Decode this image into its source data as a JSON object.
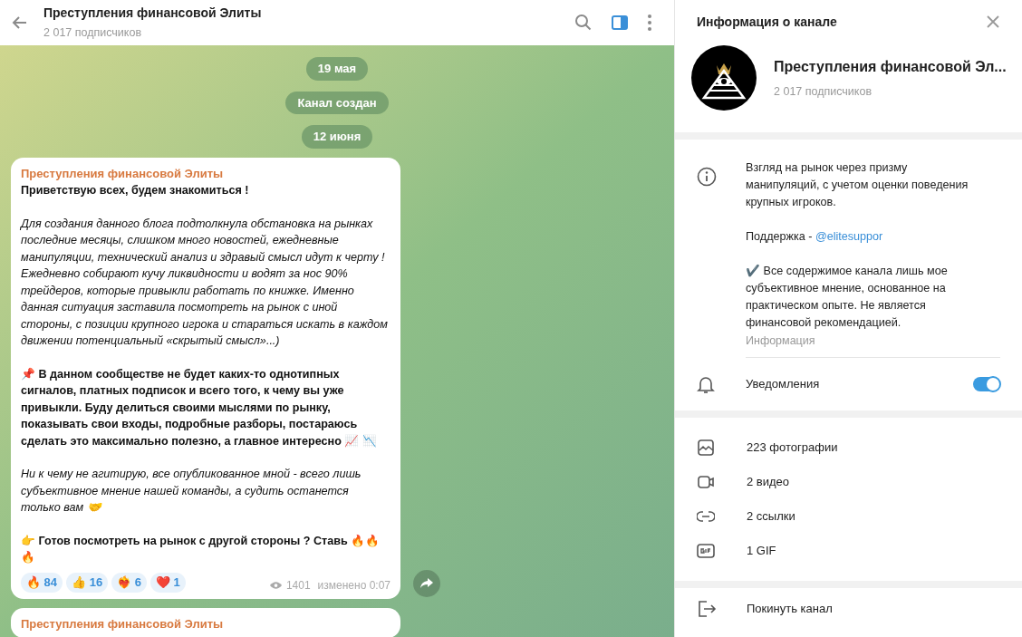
{
  "header": {
    "title": "Преступления финансовой Элиты",
    "subtitle": "2 017 подписчиков"
  },
  "service_messages": [
    "19 мая",
    "Канал создан",
    "12 июня"
  ],
  "messages": [
    {
      "sender": "Преступления финансовой Элиты",
      "paragraphs": [
        {
          "kind": "bold",
          "text": "Приветствую всех, будем знакомиться !"
        },
        {
          "kind": "italic",
          "text": "Для создания данного блога подтолкнула обстановка на рынках последние месяцы, слишком много новостей, ежедневные манипуляции, технический анализ и здравый смысл идут к черту ! Ежедневно собирают кучу ликвидности и водят за нос 90% трейдеров, которые привыкли работать по книжке. Именно данная ситуация заставила посмотреть на рынок с иной стороны, с позиции крупного игрока и стараться искать в каждом движении потенциальный «скрытый смысл»...)"
        },
        {
          "kind": "bold",
          "text": "📌 В данном сообществе не будет каких-то однотипных сигналов, платных подписок и всего того, к чему вы уже привыкли. Буду делиться своими мыслями по рынку, показывать свои входы, подробные разборы, постараюсь сделать это максимально полезно, а главное интересно 📈 📉"
        },
        {
          "kind": "italic",
          "text": "Ни к чему не агитирую, все опубликованное мной - всего лишь субъективное мнение нашей команды, а судить останется только вам 🤝"
        },
        {
          "kind": "bold",
          "text": "👉 Готов посмотреть на рынок с другой стороны ? Ставь 🔥🔥🔥"
        }
      ],
      "reactions": [
        {
          "emoji": "🔥",
          "count": "84"
        },
        {
          "emoji": "👍",
          "count": "16"
        },
        {
          "emoji": "❤️‍🔥",
          "count": "6"
        },
        {
          "emoji": "❤️",
          "count": "1"
        }
      ],
      "views": "1401",
      "edited": "изменено 0:07"
    },
    {
      "sender": "Преступления финансовой Элиты"
    }
  ],
  "info_panel": {
    "title": "Информация о канале",
    "channel_name": "Преступления финансовой Эл...",
    "subscribers": "2 017 подписчиков",
    "description": [
      {
        "text": "Взгляд на рынок через призму манипуляций, с учетом оценки поведения крупных игроков."
      },
      {
        "text": "Поддержка - ",
        "link": "@elitesuppor"
      },
      {
        "text": "✔️ Все содержимое канала лишь мое субъективное мнение, основанное на практическом опыте. Не является финансовой рекомендацией."
      }
    ],
    "description_label": "Информация",
    "notifications": {
      "label": "Уведомления",
      "on": true
    },
    "media": [
      {
        "kind": "photo",
        "label": "223 фотографии"
      },
      {
        "kind": "video",
        "label": "2 видео"
      },
      {
        "kind": "link",
        "label": "2 ссылки"
      },
      {
        "kind": "gif",
        "label": "1 GIF"
      }
    ],
    "leave": "Покинуть канал"
  }
}
